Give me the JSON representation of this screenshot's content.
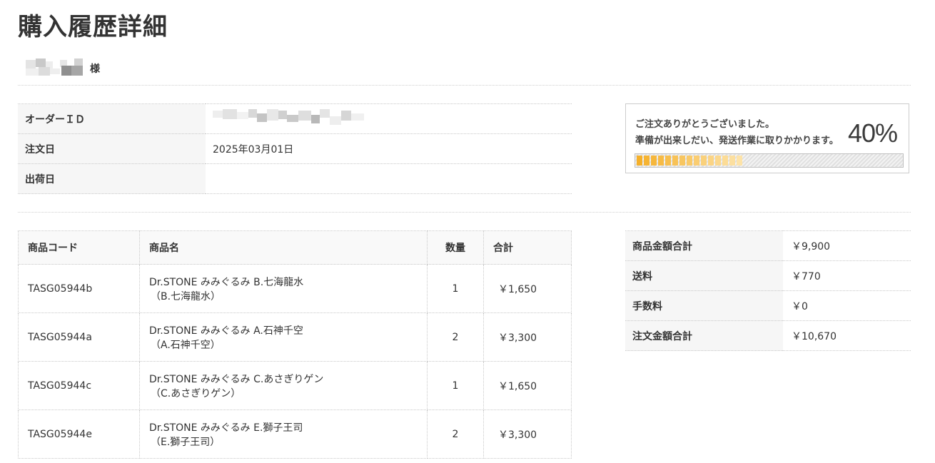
{
  "page": {
    "title": "購入履歴詳細"
  },
  "customer": {
    "honorific": "様"
  },
  "order_info": [
    {
      "label": "オーダーＩＤ",
      "value": ""
    },
    {
      "label": "注文日",
      "value": "2025年03月01日"
    },
    {
      "label": "出荷日",
      "value": ""
    }
  ],
  "status": {
    "line1": "ご注文ありがとうございました。",
    "line2": "準備が出来しだい、発送作業に取りかかります。",
    "percent_label": "40%",
    "progress": 0.4,
    "colors": {
      "bar_strong": "#f5b02a",
      "bar_light": "#fde3a8"
    }
  },
  "items": {
    "headers": {
      "code": "商品コード",
      "name": "商品名",
      "qty": "数量",
      "total": "合計"
    },
    "rows": [
      {
        "code": "TASG05944b",
        "name": "Dr.STONE みみぐるみ B.七海龍水",
        "variant": "（B.七海龍水）",
        "qty": "1",
        "total": "￥1,650"
      },
      {
        "code": "TASG05944a",
        "name": "Dr.STONE みみぐるみ A.石神千空",
        "variant": "（A.石神千空）",
        "qty": "2",
        "total": "￥3,300"
      },
      {
        "code": "TASG05944c",
        "name": "Dr.STONE みみぐるみ C.あさぎりゲン",
        "variant": "（C.あさぎりゲン）",
        "qty": "1",
        "total": "￥1,650"
      },
      {
        "code": "TASG05944e",
        "name": "Dr.STONE みみぐるみ E.獅子王司",
        "variant": "（E.獅子王司）",
        "qty": "2",
        "total": "￥3,300"
      }
    ]
  },
  "summary": [
    {
      "label": "商品金額合計",
      "value": "￥9,900"
    },
    {
      "label": "送料",
      "value": "￥770"
    },
    {
      "label": "手数料",
      "value": "￥0"
    },
    {
      "label": "注文金額合計",
      "value": "￥10,670"
    }
  ]
}
